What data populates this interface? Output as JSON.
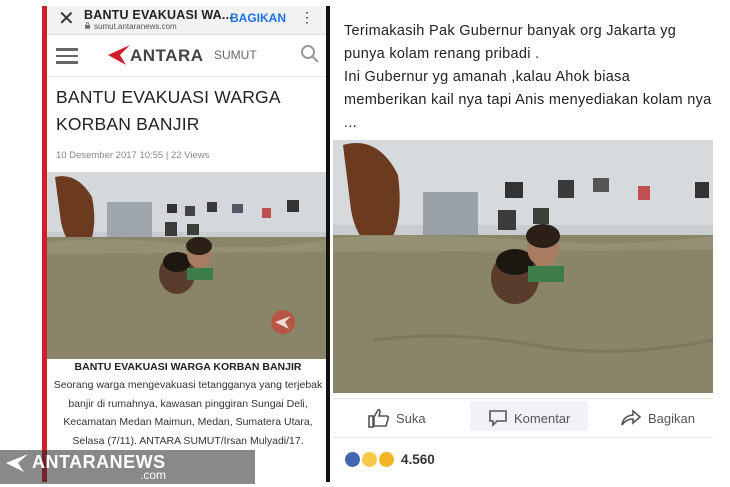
{
  "left": {
    "tab_title": "BANTU EVAKUASI WA...",
    "tab_url": "sumut.antaranews.com",
    "share_label": "BAGIKAN",
    "logo_text": "ANTARA",
    "logo_sub": "SUMUT",
    "article_title": "BANTU EVAKUASI WARGA KORBAN BANJIR",
    "meta": "10 Desember 2017 10:55 | 22 Views",
    "caption_title": "BANTU EVAKUASI WARGA KORBAN BANJIR",
    "caption_body": "Seorang warga mengevakuasi tetangganya yang terjebak banjir di rumahnya, kawasan pinggiran Sungai Deli, Kecamatan Medan Maimun, Medan, Sumatera Utara, Selasa (7/11). ANTARA SUMUT/Irsan Mulyadi/17."
  },
  "watermark": {
    "text": "ANTARANEWS",
    "domain": ".com"
  },
  "right": {
    "post_text": "Terimakasih Pak Gubernur banyak org Jakarta yg punya kolam renang pribadi .\nIni Gubernur yg amanah ,kalau Ahok biasa memberikan kail nya tapi Anis menyediakan kolam nya ...",
    "actions": {
      "like": "Suka",
      "comment": "Komentar",
      "share": "Bagikan"
    },
    "reaction_count": "4.560"
  },
  "colors": {
    "antara_red": "#d11f2a",
    "fb_blue": "#4267b2",
    "water": "#8a8468"
  },
  "icons": [
    "close-icon",
    "kebab-icon",
    "hamburger-icon",
    "search-icon",
    "lock-icon",
    "like-icon",
    "comment-icon",
    "share-icon"
  ]
}
